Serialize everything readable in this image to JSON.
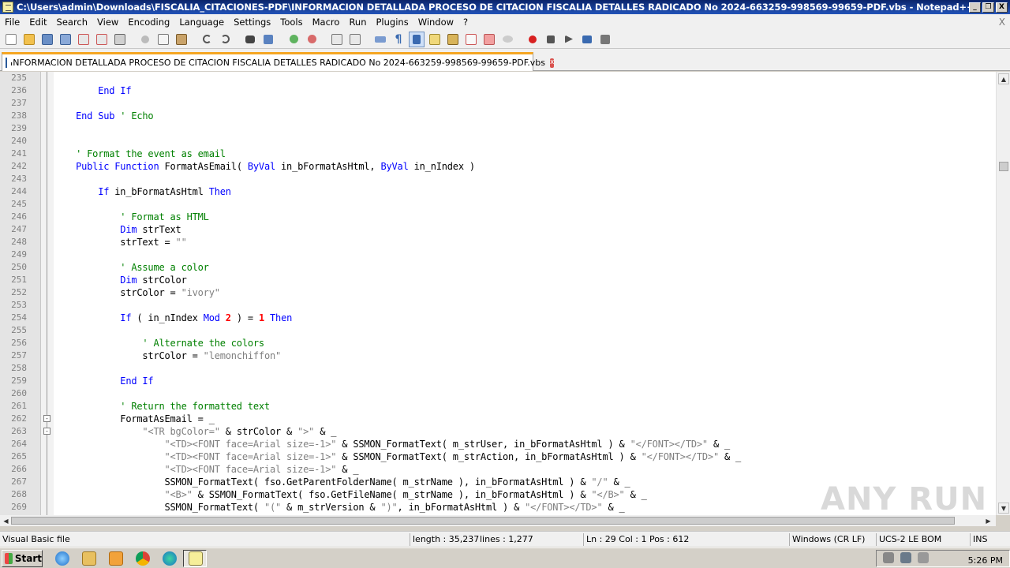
{
  "window": {
    "title": "C:\\Users\\admin\\Downloads\\FISCALIA_CITACIONES-PDF\\INFORMACION DETALLADA PROCESO DE CITACION FISCALIA DETALLES RADICADO No 2024-663259-998569-99659-PDF.vbs - Notepad++",
    "min_label": "_",
    "restore_label": "❐",
    "close_label": "X"
  },
  "menu": {
    "items": [
      "File",
      "Edit",
      "Search",
      "View",
      "Encoding",
      "Language",
      "Settings",
      "Tools",
      "Macro",
      "Run",
      "Plugins",
      "Window",
      "?"
    ],
    "close_label": "X"
  },
  "tab": {
    "label": "INFORMACION DETALLADA PROCESO DE CITACION FISCALIA DETALLES RADICADO No 2024-663259-998569-99659-PDF.vbs",
    "close_label": "x"
  },
  "editor": {
    "lines": [
      {
        "n": "235",
        "indent": 0,
        "code": []
      },
      {
        "n": "236",
        "indent": 0,
        "code": [
          [
            "kw",
            "        End If"
          ]
        ]
      },
      {
        "n": "237",
        "indent": 0,
        "code": []
      },
      {
        "n": "238",
        "indent": 0,
        "code": [
          [
            "kw",
            "    End Sub"
          ],
          [
            "cm",
            " ' Echo"
          ]
        ]
      },
      {
        "n": "239",
        "indent": 0,
        "code": []
      },
      {
        "n": "240",
        "indent": 0,
        "code": []
      },
      {
        "n": "241",
        "indent": 0,
        "code": [
          [
            "cm",
            "    ' Format the event as email"
          ]
        ]
      },
      {
        "n": "242",
        "indent": 0,
        "code": [
          [
            "kw",
            "    Public Function"
          ],
          [
            "tx",
            " FormatAsEmail( "
          ],
          [
            "kw",
            "ByVal"
          ],
          [
            "tx",
            " in_bFormatAsHtml, "
          ],
          [
            "kw",
            "ByVal"
          ],
          [
            "tx",
            " in_nIndex )"
          ]
        ]
      },
      {
        "n": "243",
        "indent": 0,
        "code": []
      },
      {
        "n": "244",
        "indent": 0,
        "code": [
          [
            "kw",
            "        If"
          ],
          [
            "tx",
            " in_bFormatAsHtml "
          ],
          [
            "kw",
            "Then"
          ]
        ]
      },
      {
        "n": "245",
        "indent": 0,
        "code": []
      },
      {
        "n": "246",
        "indent": 0,
        "code": [
          [
            "cm",
            "            ' Format as HTML"
          ]
        ]
      },
      {
        "n": "247",
        "indent": 0,
        "code": [
          [
            "kw",
            "            Dim"
          ],
          [
            "tx",
            " strText"
          ]
        ]
      },
      {
        "n": "248",
        "indent": 0,
        "code": [
          [
            "tx",
            "            strText = "
          ],
          [
            "st",
            "\"\""
          ]
        ]
      },
      {
        "n": "249",
        "indent": 0,
        "code": []
      },
      {
        "n": "250",
        "indent": 0,
        "code": [
          [
            "cm",
            "            ' Assume a color"
          ]
        ]
      },
      {
        "n": "251",
        "indent": 0,
        "code": [
          [
            "kw",
            "            Dim"
          ],
          [
            "tx",
            " strColor"
          ]
        ]
      },
      {
        "n": "252",
        "indent": 0,
        "code": [
          [
            "tx",
            "            strColor = "
          ],
          [
            "st",
            "\"ivory\""
          ]
        ]
      },
      {
        "n": "253",
        "indent": 0,
        "code": []
      },
      {
        "n": "254",
        "indent": 0,
        "code": [
          [
            "kw",
            "            If"
          ],
          [
            "tx",
            " ( in_nIndex "
          ],
          [
            "kw",
            "Mod"
          ],
          [
            "tx",
            " "
          ],
          [
            "nm",
            "2"
          ],
          [
            "tx",
            " ) = "
          ],
          [
            "nm",
            "1"
          ],
          [
            "tx",
            " "
          ],
          [
            "kw",
            "Then"
          ]
        ]
      },
      {
        "n": "255",
        "indent": 0,
        "code": []
      },
      {
        "n": "256",
        "indent": 0,
        "code": [
          [
            "cm",
            "                ' Alternate the colors"
          ]
        ]
      },
      {
        "n": "257",
        "indent": 0,
        "code": [
          [
            "tx",
            "                strColor = "
          ],
          [
            "st",
            "\"lemonchiffon\""
          ]
        ]
      },
      {
        "n": "258",
        "indent": 0,
        "code": []
      },
      {
        "n": "259",
        "indent": 0,
        "code": [
          [
            "kw",
            "            End If"
          ]
        ]
      },
      {
        "n": "260",
        "indent": 0,
        "code": []
      },
      {
        "n": "261",
        "indent": 0,
        "code": [
          [
            "cm",
            "            ' Return the formatted text"
          ]
        ]
      },
      {
        "n": "262",
        "indent": 0,
        "fold": "-",
        "code": [
          [
            "tx",
            "            FormatAsEmail = _"
          ]
        ]
      },
      {
        "n": "263",
        "indent": 0,
        "fold": "-",
        "code": [
          [
            "st",
            "                \"<TR bgColor=\""
          ],
          [
            "tx",
            " & strColor & "
          ],
          [
            "st",
            "\">\""
          ],
          [
            "tx",
            " & _"
          ]
        ]
      },
      {
        "n": "264",
        "indent": 0,
        "code": [
          [
            "st",
            "                    \"<TD><FONT face=Arial size=-1>\""
          ],
          [
            "tx",
            " & SSMON_FormatText( m_strUser, in_bFormatAsHtml ) & "
          ],
          [
            "st",
            "\"</FONT></TD>\""
          ],
          [
            "tx",
            " & _"
          ]
        ]
      },
      {
        "n": "265",
        "indent": 0,
        "code": [
          [
            "st",
            "                    \"<TD><FONT face=Arial size=-1>\""
          ],
          [
            "tx",
            " & SSMON_FormatText( m_strAction, in_bFormatAsHtml ) & "
          ],
          [
            "st",
            "\"</FONT></TD>\""
          ],
          [
            "tx",
            " & _"
          ]
        ]
      },
      {
        "n": "266",
        "indent": 0,
        "code": [
          [
            "st",
            "                    \"<TD><FONT face=Arial size=-1>\""
          ],
          [
            "tx",
            " & _"
          ]
        ]
      },
      {
        "n": "267",
        "indent": 0,
        "code": [
          [
            "tx",
            "                    SSMON_FormatText( fso.GetParentFolderName( m_strName ), in_bFormatAsHtml ) & "
          ],
          [
            "st",
            "\"/\""
          ],
          [
            "tx",
            " & _"
          ]
        ]
      },
      {
        "n": "268",
        "indent": 0,
        "code": [
          [
            "st",
            "                    \"<B>\""
          ],
          [
            "tx",
            " & SSMON_FormatText( fso.GetFileName( m_strName ), in_bFormatAsHtml ) & "
          ],
          [
            "st",
            "\"</B>\""
          ],
          [
            "tx",
            " & _"
          ]
        ]
      },
      {
        "n": "269",
        "indent": 0,
        "code": [
          [
            "tx",
            "                    SSMON_FormatText( "
          ],
          [
            "st",
            "\"(\""
          ],
          [
            "tx",
            " & m_strVersion & "
          ],
          [
            "st",
            "\")\""
          ],
          [
            "tx",
            ", in_bFormatAsHtml ) & "
          ],
          [
            "st",
            "\"</FONT></TD>\""
          ],
          [
            "tx",
            " & _"
          ]
        ]
      }
    ]
  },
  "watermark": "ANY RUN",
  "status": {
    "file_type": "Visual Basic file",
    "length": "length : 35,237",
    "lines": "lines : 1,277",
    "position": "Ln : 29    Col : 1    Pos : 612",
    "eol": "Windows (CR LF)",
    "encoding": "UCS-2 LE BOM",
    "mode": "INS"
  },
  "taskbar": {
    "start_label": "Start",
    "clock": "5:26 PM"
  }
}
